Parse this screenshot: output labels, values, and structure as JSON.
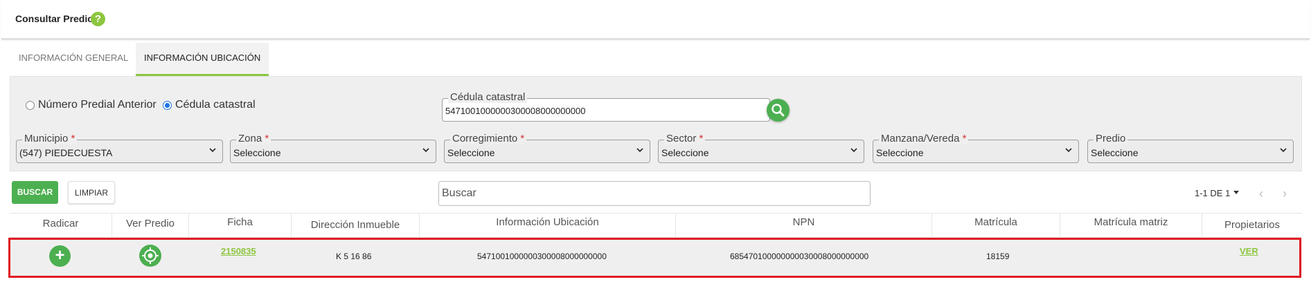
{
  "header": {
    "title": "Consultar Predio",
    "help_glyph": "?"
  },
  "tabs": [
    {
      "label": "INFORMACIÓN GENERAL"
    },
    {
      "label": "INFORMACIÓN UBICACIÓN"
    }
  ],
  "filters": {
    "radio_anterior": "Número Predial Anterior",
    "radio_cedula": "Cédula catastral",
    "cedula_label": "Cédula catastral",
    "cedula_value": "5471001000000300008000000000",
    "required_mark": "*",
    "selects": [
      {
        "label": "Municipio",
        "value": "(547) PIEDECUESTA",
        "required": true
      },
      {
        "label": "Zona",
        "value": "Seleccione",
        "required": true
      },
      {
        "label": "Corregimiento",
        "value": "Seleccione",
        "required": true
      },
      {
        "label": "Sector",
        "value": "Seleccione",
        "required": true
      },
      {
        "label": "Manzana/Vereda",
        "value": "Seleccione",
        "required": true
      },
      {
        "label": "Predio",
        "value": "Seleccione",
        "required": false
      }
    ]
  },
  "toolbar": {
    "buscar_label": "BUSCAR",
    "limpiar_label": "LIMPIAR",
    "search_placeholder": "Buscar",
    "pager_text": "1-1 DE 1",
    "prev_glyph": "‹",
    "next_glyph": "›"
  },
  "table": {
    "columns": [
      "Radicar",
      "Ver Predio",
      "Ficha",
      "Dirección Inmueble",
      "Información Ubicación",
      "NPN",
      "Matrícula",
      "Matrícula matriz",
      "Propietarios"
    ],
    "rows": [
      {
        "radicar_glyph": "+",
        "ficha": "2150835",
        "direccion": "K 5 16 86",
        "ubicacion": "5471001000000300008000000000",
        "npn": "685470100000000030008000000000",
        "matricula": "18159",
        "matricula_matriz": "",
        "propietarios": "VER"
      }
    ]
  },
  "colors": {
    "accent_green": "#8cc63f",
    "button_green": "#4caf50",
    "highlight_red": "#e01b24"
  }
}
